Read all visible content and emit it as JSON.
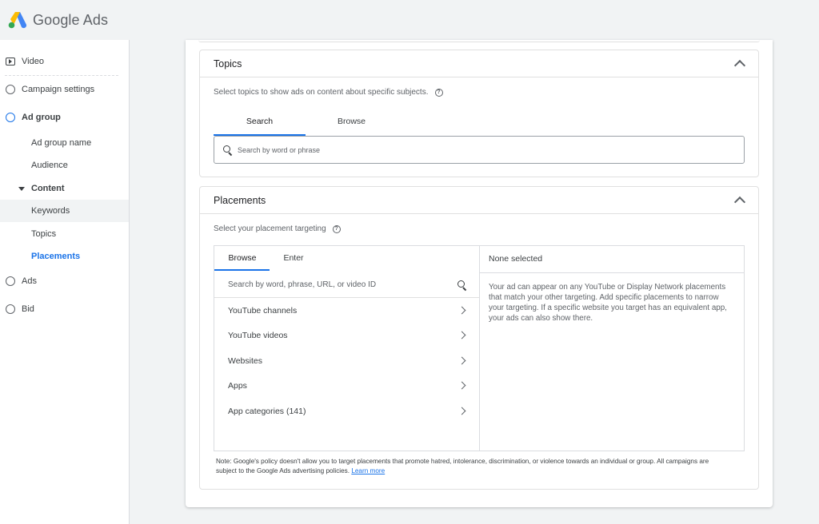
{
  "app": {
    "brand_google": "Google",
    "brand_ads": "Ads"
  },
  "sidebar": {
    "items": [
      {
        "label": "Video"
      },
      {
        "label": "Campaign settings"
      },
      {
        "label": "Ad group"
      },
      {
        "label": "Ad group name"
      },
      {
        "label": "Audience"
      },
      {
        "label": "Content"
      },
      {
        "label": "Keywords"
      },
      {
        "label": "Topics"
      },
      {
        "label": "Placements"
      },
      {
        "label": "Ads"
      },
      {
        "label": "Bid"
      }
    ]
  },
  "topics": {
    "title": "Topics",
    "description": "Select topics to show ads on content about specific subjects.",
    "tabs": [
      "Search",
      "Browse"
    ],
    "search_placeholder": "Search by word or phrase"
  },
  "placements": {
    "title": "Placements",
    "description": "Select your placement targeting",
    "tabs": [
      "Browse",
      "Enter"
    ],
    "search_placeholder": "Search by word, phrase, URL, or video ID",
    "list": [
      "YouTube channels",
      "YouTube videos",
      "Websites",
      "Apps",
      "App categories (141)"
    ],
    "selected_header": "None selected",
    "selected_text": "Your ad can appear on any YouTube or Display Network placements that match your other targeting. Add specific placements to narrow your targeting. If a specific website you target has an equivalent app, your ads can also show there.",
    "note": "Note: Google's policy doesn't allow you to target placements that promote hatred, intolerance, discrimination, or violence towards an individual or group. All campaigns are subject to the Google Ads advertising policies.",
    "learn_more": "Learn more"
  },
  "colors": {
    "accent": "#1a73e8",
    "text": "#3c4043",
    "border": "#dadce0"
  }
}
